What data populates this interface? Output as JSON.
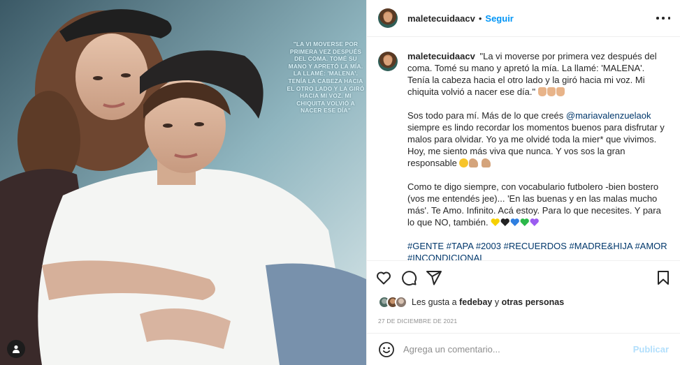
{
  "media": {
    "overlay_quote": "\"La vi moverse por primera vez después del coma. Tomé su mano y apretó la mía. La llamé: 'Malena'. Tenía la cabeza hacia el otro lado y la giró hacia mi voz. Mi chiquita volvió a nacer ese día\""
  },
  "header": {
    "username": "maletecuidaacv",
    "separator": "•",
    "follow_label": "Seguir"
  },
  "caption": {
    "username": "maletecuidaacv",
    "paragraph1": "\"La vi moverse por primera vez después del coma. Tomé su mano y apretó la mía. La llamé: 'MALENA'. Tenía la cabeza hacia el otro lado y la giró hacia mi voz. Mi chiquita volvió a nacer ese día.\"",
    "paragraph2_before": "Sos todo para mí. Más de lo que creés ",
    "mention": "@mariavalenzuelaok",
    "paragraph2_after": " siempre es lindo recordar los momentos buenos para disfrutar y malos para olvidar. Yo ya me olvidé toda la mier* que vivimos. Hoy, me siento más viva que nunca. Y vos sos la gran responsable ",
    "paragraph3": "Como te digo siempre, con vocabulario futbolero -bien bostero (vos me entendés jee)... 'En las buenas y en las malas mucho más'. Te Amo. Infinito. Acá estoy. Para lo que necesites. Y para lo que NO, también. ",
    "hashtags": [
      "#GENTE",
      "#TAPA",
      "#2003",
      "#RECUERDOS",
      "#MADRE&HIJA",
      "#AMOR",
      "#INCONDICIONAL"
    ]
  },
  "icons": {
    "like": "heart-icon",
    "comment": "comment-icon",
    "share": "share-icon",
    "save": "bookmark-icon",
    "more": "more-options-icon",
    "emoji": "emoji-icon",
    "tag": "tagged-user-icon"
  },
  "likes": {
    "prefix": "Les gusta a ",
    "user": "fedebay",
    "middle": " y ",
    "others": "otras personas"
  },
  "date": "27 DE DICIEMBRE DE 2021",
  "composer": {
    "placeholder": "Agrega un comentario...",
    "publish_label": "Publicar"
  },
  "colors": {
    "link_blue": "#0095f6",
    "hashtag_blue": "#00376b",
    "publish_disabled": "#b2dffc",
    "muted": "#8e8e8e"
  }
}
